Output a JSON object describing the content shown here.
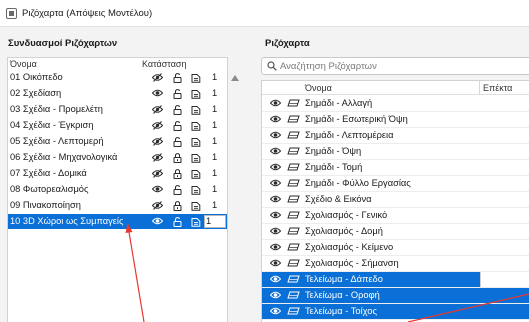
{
  "window": {
    "title": "Ριζόχαρτα (Απόψεις Μοντέλου)"
  },
  "left_panel": {
    "title": "Συνδυασμοί Ριζόχαρτων",
    "columns": {
      "name": "Όνομα",
      "state": "Κατάσταση"
    },
    "rows": [
      {
        "name": "01 Οικόπεδο",
        "eye": "eye-slash",
        "lock": "unlocked",
        "num": "1",
        "selected": false
      },
      {
        "name": "02 Σχεδίαση",
        "eye": "eye",
        "lock": "unlocked",
        "num": "1",
        "selected": false
      },
      {
        "name": "03 Σχέδια - Προμελέτη",
        "eye": "eye-slash",
        "lock": "unlocked",
        "num": "1",
        "selected": false
      },
      {
        "name": "04 Σχέδια - Έγκριση",
        "eye": "eye-slash",
        "lock": "unlocked",
        "num": "1",
        "selected": false
      },
      {
        "name": "05 Σχέδια - Λεπτομερή",
        "eye": "eye-slash",
        "lock": "unlocked",
        "num": "1",
        "selected": false
      },
      {
        "name": "06 Σχέδια - Μηχανολογικά",
        "eye": "eye-slash",
        "lock": "locked",
        "num": "1",
        "selected": false
      },
      {
        "name": "07 Σχέδια - Δομικά",
        "eye": "eye-slash",
        "lock": "locked",
        "num": "1",
        "selected": false
      },
      {
        "name": "08 Φωτορεαλισμός",
        "eye": "eye",
        "lock": "unlocked",
        "num": "1",
        "selected": false
      },
      {
        "name": "09 Πινακοποίηση",
        "eye": "eye-slash",
        "lock": "locked",
        "num": "1",
        "selected": false
      },
      {
        "name": "10 3D Χώροι ως Συμπαγείς",
        "eye": "eye",
        "lock": "unlocked",
        "num": "1",
        "selected": true
      }
    ]
  },
  "right_panel": {
    "title": "Ριζόχαρτα",
    "search": {
      "placeholder": "Αναζήτηση Ριζόχαρτων",
      "value": ""
    },
    "columns": {
      "name": "Όνομα",
      "ext": "Επέκτα"
    },
    "rows": [
      {
        "name": "Σημάδι - Αλλαγή",
        "selected": false
      },
      {
        "name": "Σημάδι - Εσωτερική Όψη",
        "selected": false
      },
      {
        "name": "Σημάδι - Λεπτομέρεια",
        "selected": false
      },
      {
        "name": "Σημάδι - Όψη",
        "selected": false
      },
      {
        "name": "Σημάδι - Τομή",
        "selected": false
      },
      {
        "name": "Σημάδι - Φύλλο Εργασίας",
        "selected": false
      },
      {
        "name": "Σχέδιο & Εικόνα",
        "selected": false
      },
      {
        "name": "Σχολιασμός - Γενικό",
        "selected": false
      },
      {
        "name": "Σχολιασμός - Δομή",
        "selected": false
      },
      {
        "name": "Σχολιασμός - Κείμενο",
        "selected": false
      },
      {
        "name": "Σχολιασμός - Σήμανση",
        "selected": false
      },
      {
        "name": "Τελείωμα - Δάπεδο",
        "selected": true
      },
      {
        "name": "Τελείωμα - Οροφή",
        "selected": true
      },
      {
        "name": "Τελείωμα - Τοίχος",
        "selected": true
      }
    ]
  },
  "colors": {
    "selection": "#0a6fd6",
    "annotation_arrow": "#e8382e",
    "panel_bg": "#f3f3f3"
  },
  "icons": [
    "eye-icon",
    "eye-slash-icon",
    "lock-icon",
    "unlock-icon",
    "layer-icon",
    "search-icon",
    "scroll-up-icon"
  ]
}
